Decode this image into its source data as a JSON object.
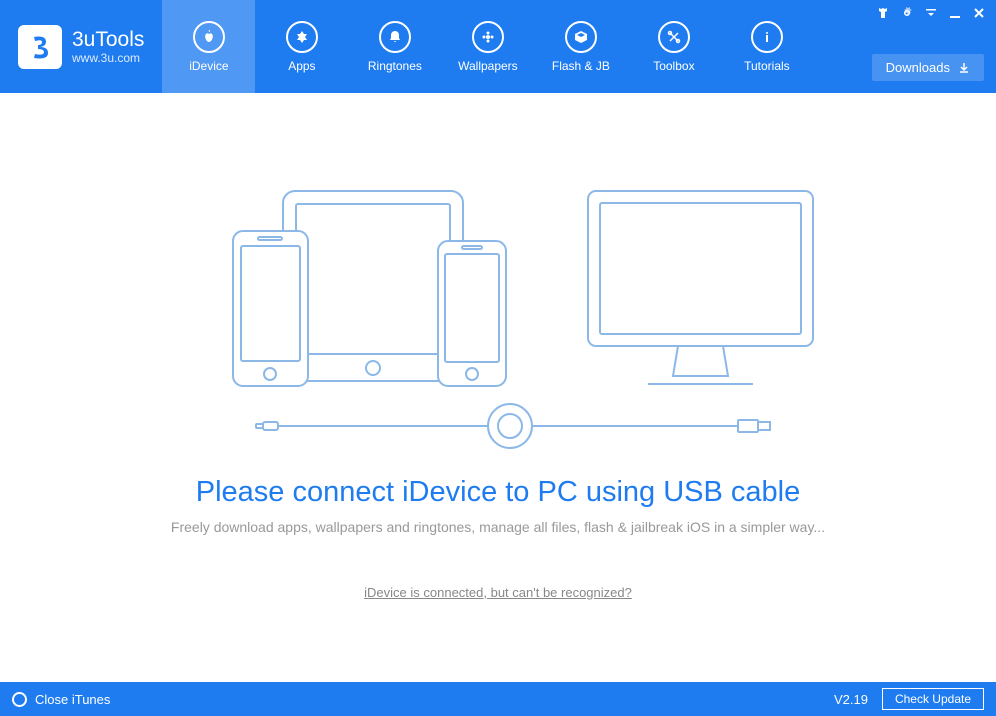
{
  "brand": {
    "title": "3uTools",
    "url": "www.3u.com"
  },
  "nav": [
    {
      "label": "iDevice",
      "icon": "apple-icon",
      "active": true
    },
    {
      "label": "Apps",
      "icon": "apps-icon"
    },
    {
      "label": "Ringtones",
      "icon": "bell-icon"
    },
    {
      "label": "Wallpapers",
      "icon": "flower-icon"
    },
    {
      "label": "Flash & JB",
      "icon": "box-icon"
    },
    {
      "label": "Toolbox",
      "icon": "tools-icon"
    },
    {
      "label": "Tutorials",
      "icon": "info-icon"
    }
  ],
  "downloads_label": "Downloads",
  "main": {
    "headline": "Please connect iDevice to PC using USB cable",
    "subhead": "Freely download apps, wallpapers and ringtones, manage all files, flash & jailbreak iOS in a simpler way...",
    "help_link": "iDevice is connected, but can't be recognized?"
  },
  "footer": {
    "close_itunes": "Close iTunes",
    "version": "V2.19",
    "check_update": "Check Update"
  }
}
